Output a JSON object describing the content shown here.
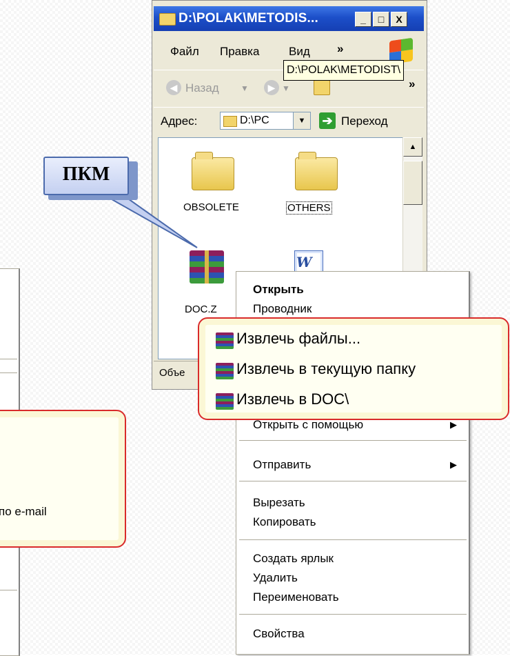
{
  "window": {
    "title": "D:\\POLAK\\METODIS...",
    "buttons": [
      "_",
      "□",
      "X"
    ],
    "menu": [
      "Файл",
      "Правка",
      "Вид"
    ],
    "menu_more": "»",
    "tooltip": "D:\\POLAK\\METODIST\\",
    "toolbar": {
      "back": "Назад",
      "more": "»"
    },
    "address": {
      "label": "Адрес:",
      "value": "D:\\PC",
      "go": "Переход"
    },
    "files": [
      {
        "name": "OBSOLETE",
        "icon": "folder-icon"
      },
      {
        "name": "OTHERS",
        "icon": "folder-icon"
      },
      {
        "name": "DOC.Z",
        "icon": "winrar-archive-icon"
      },
      {
        "name": "",
        "icon": "word-document-icon"
      }
    ],
    "status": "Объе"
  },
  "callout": {
    "text": "ПКМ"
  },
  "context_menu": {
    "items": [
      {
        "label": "Открыть",
        "bold": true
      },
      {
        "label": "Проводник"
      },
      {
        "label": "Открыть с помощью",
        "submenu": true
      },
      {
        "label": "Отправить",
        "submenu": true
      },
      {
        "label": "Вырезать"
      },
      {
        "label": "Копировать"
      },
      {
        "label": "Создать ярлык"
      },
      {
        "label": "Удалить"
      },
      {
        "label": "Переименовать"
      },
      {
        "label": "Свойства"
      }
    ]
  },
  "winrar_items": [
    {
      "label": "Извлечь файлы..."
    },
    {
      "label": "Извлечь в текущую папку"
    },
    {
      "label": "Извлечь в DOC\\"
    }
  ],
  "left_panel": {
    "email_text": "по e-mail"
  },
  "colors": {
    "highlight_border": "#d92a2a",
    "titlebar": "#1c4fc9",
    "callout_fill": "#c4d0f1"
  }
}
